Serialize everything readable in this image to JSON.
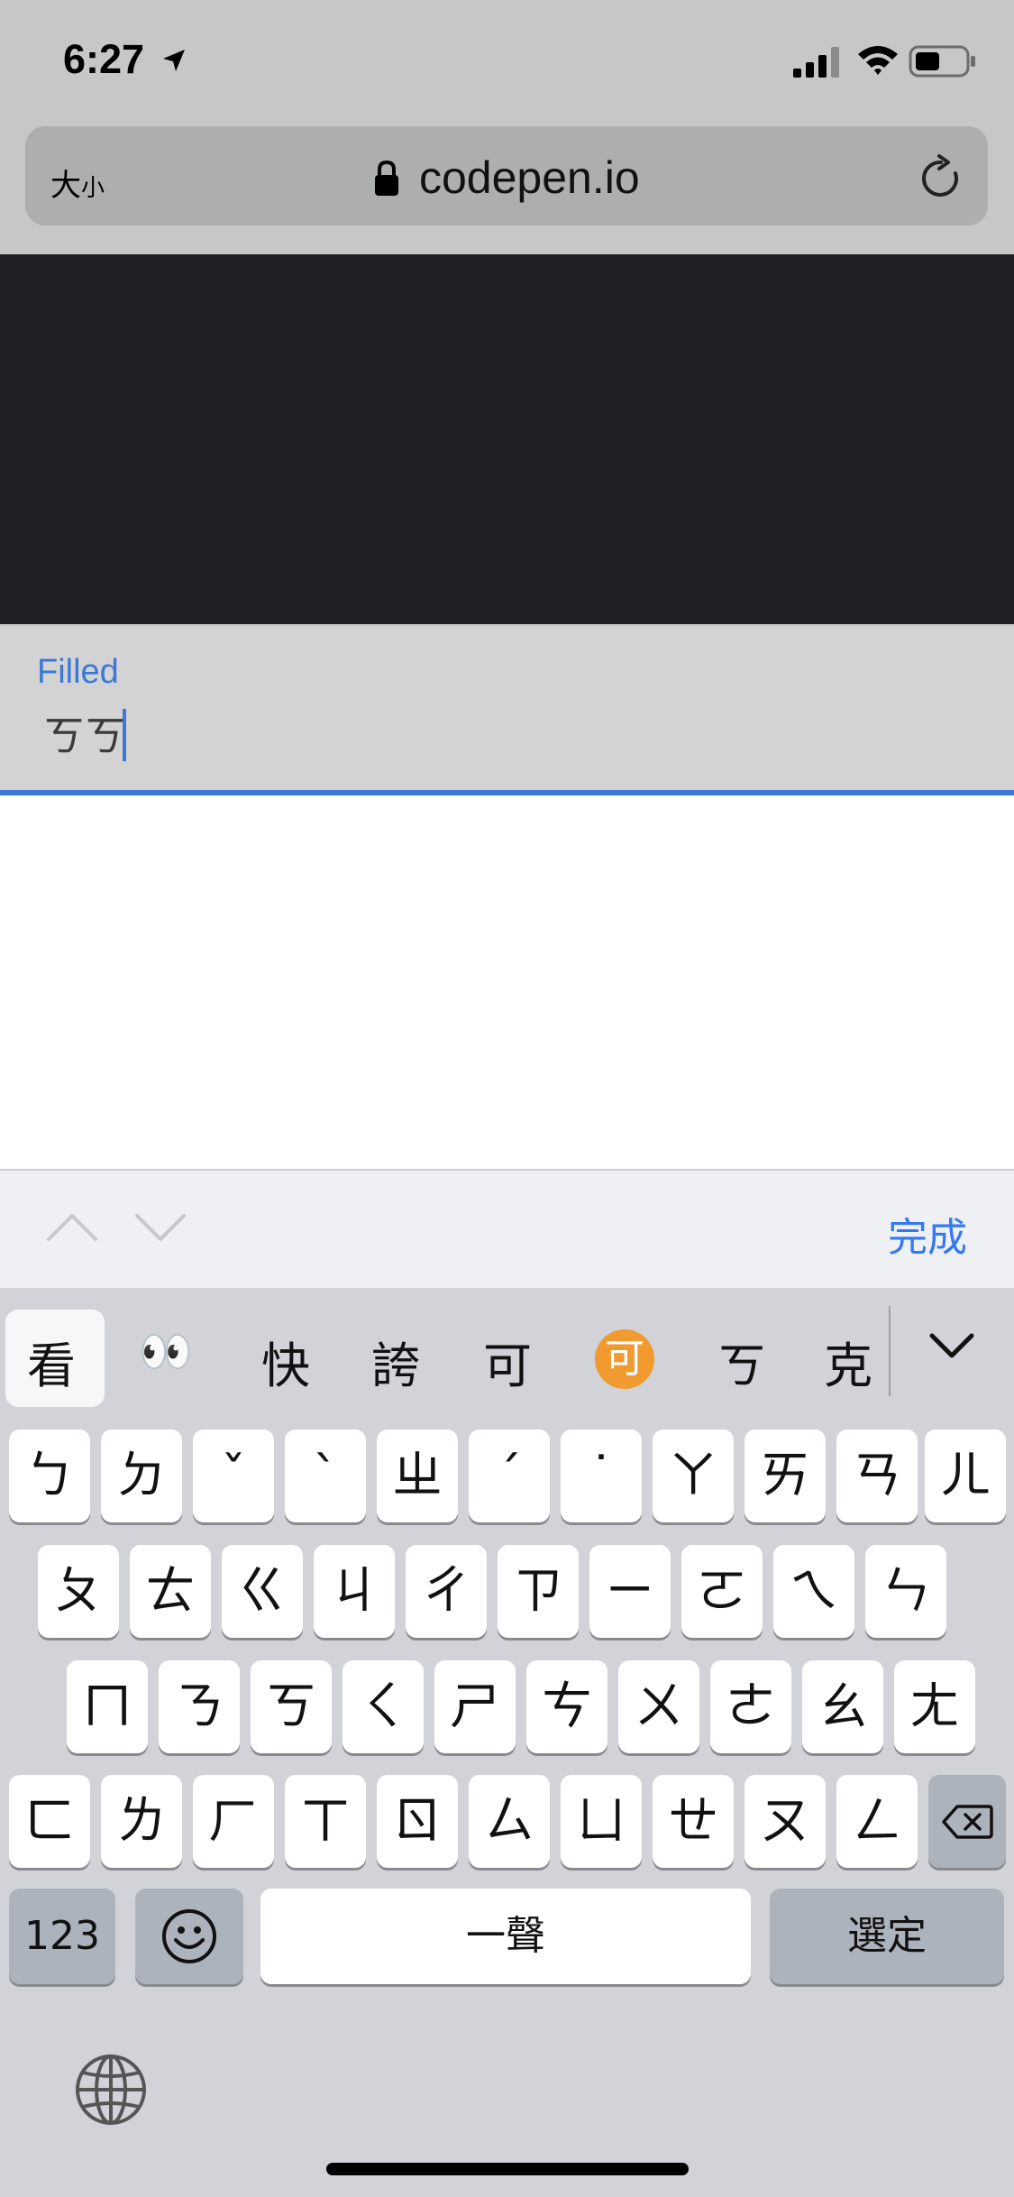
{
  "status": {
    "time": "6:27"
  },
  "browser": {
    "text_size_label_big": "大",
    "text_size_label_small": "小",
    "url": "codepen.io"
  },
  "field": {
    "label": "Filled",
    "value": "ㄎㄎ"
  },
  "accessory": {
    "done_label": "完成"
  },
  "keyboard": {
    "candidates": [
      "看",
      "👀",
      "快",
      "誇",
      "可",
      "可",
      "ㄎ",
      "克"
    ],
    "row1": [
      "ㄅ",
      "ㄉ",
      "ˇ",
      "ˋ",
      "ㄓ",
      "ˊ",
      "˙",
      "ㄚ",
      "ㄞ",
      "ㄢ",
      "ㄦ"
    ],
    "row2": [
      "ㄆ",
      "ㄊ",
      "ㄍ",
      "ㄐ",
      "ㄔ",
      "ㄗ",
      "ㄧ",
      "ㄛ",
      "ㄟ",
      "ㄣ"
    ],
    "row3": [
      "ㄇ",
      "ㄋ",
      "ㄎ",
      "ㄑ",
      "ㄕ",
      "ㄘ",
      "ㄨ",
      "ㄜ",
      "ㄠ",
      "ㄤ"
    ],
    "row4": [
      "ㄈ",
      "ㄌ",
      "ㄏ",
      "ㄒ",
      "ㄖ",
      "ㄙ",
      "ㄩ",
      "ㄝ",
      "ㄡ",
      "ㄥ"
    ],
    "numbers_label": "123",
    "space_label": "一聲",
    "confirm_label": "選定"
  },
  "icons": [
    "location-arrow-icon",
    "cellular-signal-icon",
    "wifi-icon",
    "battery-icon",
    "lock-icon",
    "reload-icon",
    "chevron-up-icon",
    "chevron-down-icon",
    "delete-key-icon",
    "emoji-icon",
    "globe-icon"
  ]
}
